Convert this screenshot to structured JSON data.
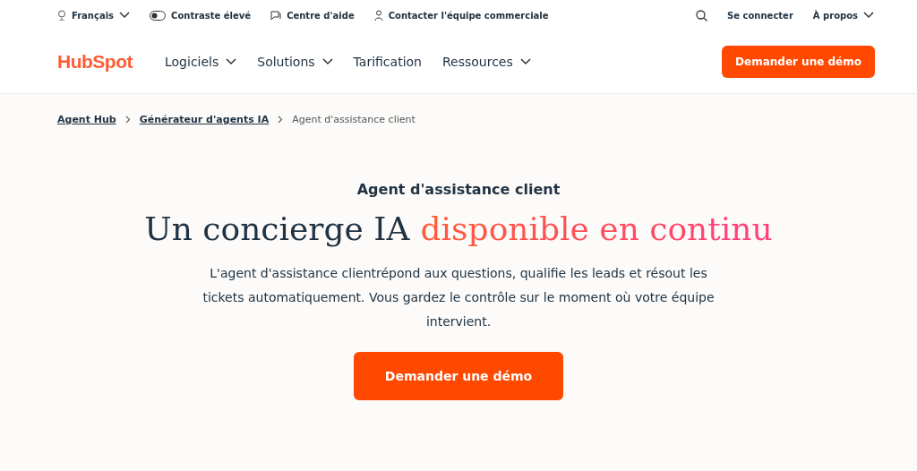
{
  "utility_bar": {
    "left": [
      {
        "kind": "language",
        "label": "Français"
      },
      {
        "kind": "contrast",
        "label": "Contraste élevé",
        "on": false
      },
      {
        "kind": "help",
        "label": "Centre d'aide"
      },
      {
        "kind": "contact",
        "label": "Contacter l'équipe commerciale"
      }
    ],
    "right": [
      {
        "kind": "search"
      },
      {
        "kind": "link",
        "label": "Se connecter"
      },
      {
        "kind": "menu",
        "label": "À propos"
      }
    ]
  },
  "nav": {
    "logo": "HubSpot",
    "items": [
      {
        "label": "Logiciels",
        "dropdown": true
      },
      {
        "label": "Solutions",
        "dropdown": true
      },
      {
        "label": "Tarification",
        "dropdown": false
      },
      {
        "label": "Ressources",
        "dropdown": true
      }
    ],
    "cta": "Demander une démo"
  },
  "breadcrumbs": [
    {
      "label": "Agent Hub",
      "link": true
    },
    {
      "label": "Générateur d'agents IA",
      "link": true
    },
    {
      "label": "Agent d'assistance client",
      "link": false
    }
  ],
  "hero": {
    "eyebrow": "Agent d'assistance client",
    "title_plain": "Un concierge IA",
    "title_accent": "disponible en continu",
    "description": "L'agent d'assistance clientrépond aux questions, qualifie les leads et résout les tickets automatiquement. Vous gardez le contrôle sur le moment où votre équipe intervient.",
    "cta": "Demander une démo"
  }
}
